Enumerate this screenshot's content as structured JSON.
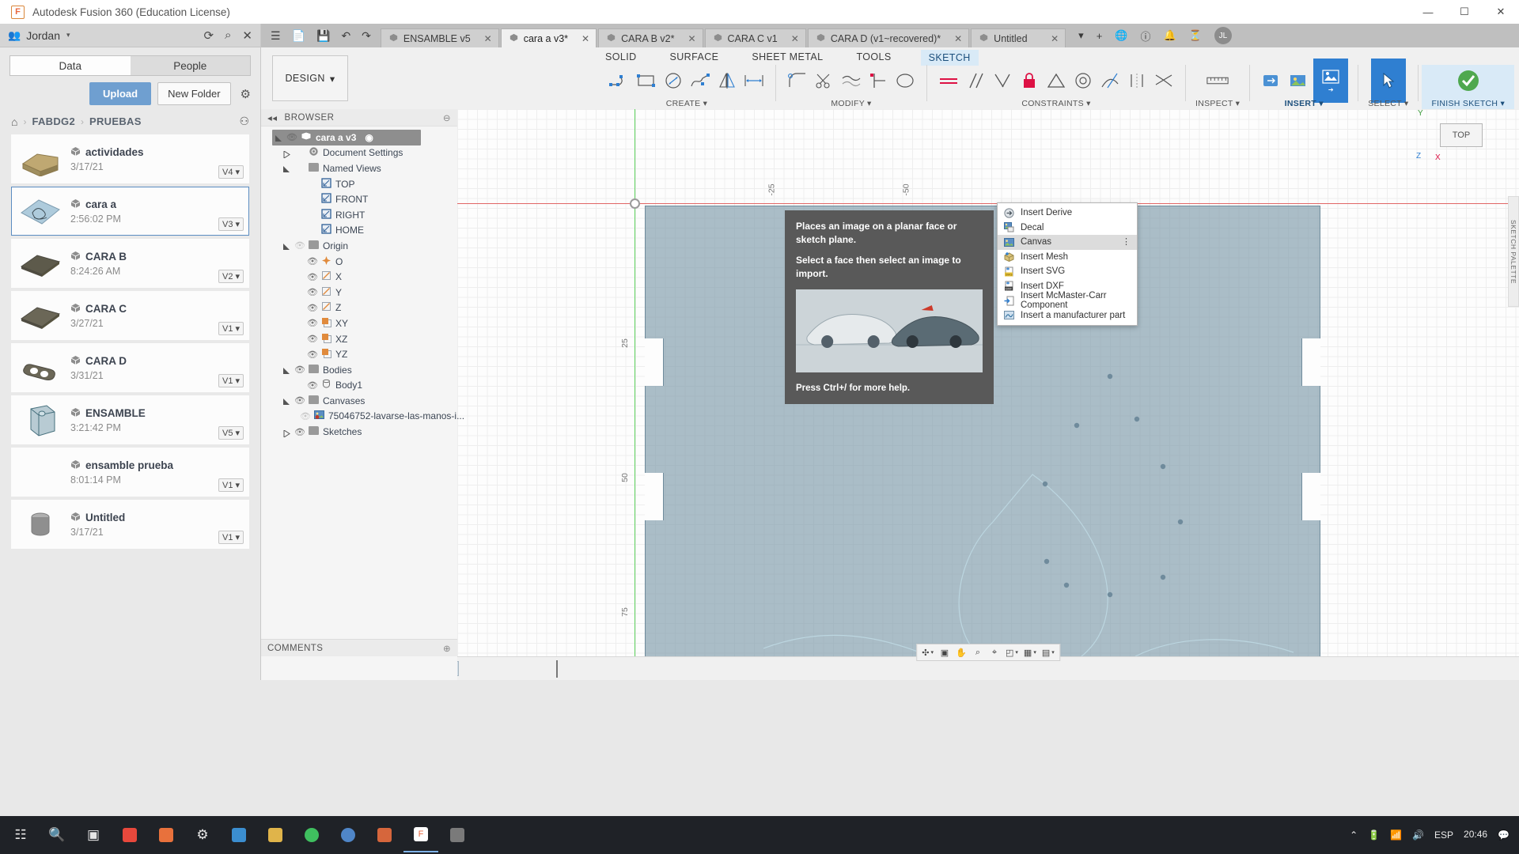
{
  "window": {
    "title": "Autodesk Fusion 360 (Education License)",
    "logo_letter": "F",
    "minimize": "—",
    "maximize": "☐",
    "close": "✕"
  },
  "data_panel": {
    "user": "Jordan",
    "user_caret": "▾",
    "people_icon": "people-icon",
    "refresh_icon": "⟳",
    "search_icon": "⌕",
    "close_icon": "✕",
    "tabs": [
      {
        "label": "Data",
        "active": true
      },
      {
        "label": "People",
        "active": false
      }
    ],
    "upload_label": "Upload",
    "new_folder_label": "New Folder",
    "settings_icon": "⚙",
    "breadcrumb": {
      "home_icon": "⌂",
      "sep": "›",
      "items": [
        "FABDG2",
        "PRUEBAS"
      ],
      "right_icon": "⚇"
    },
    "files": [
      {
        "name": "actividades",
        "date": "3/17/21",
        "version": "V4",
        "selected": false,
        "thumb": "wedge",
        "color": "#bfa872"
      },
      {
        "name": "cara a",
        "date": "2:56:02 PM",
        "version": "V3",
        "selected": true,
        "thumb": "sketch",
        "color": "#aecbdc"
      },
      {
        "name": "CARA B",
        "date": "8:24:26 AM",
        "version": "V2",
        "selected": false,
        "thumb": "plate",
        "color": "#5d5a4b"
      },
      {
        "name": "CARA C",
        "date": "3/27/21",
        "version": "V1",
        "selected": false,
        "thumb": "plate",
        "color": "#6b6757"
      },
      {
        "name": "CARA D",
        "date": "3/31/21",
        "version": "V1",
        "selected": false,
        "thumb": "keyplate",
        "color": "#6b6757"
      },
      {
        "name": "ENSAMBLE",
        "date": "3:21:42 PM",
        "version": "V5",
        "selected": false,
        "thumb": "box",
        "color": "#7fa3b0"
      },
      {
        "name": "ensamble prueba",
        "date": "8:01:14 PM",
        "version": "V1",
        "selected": false,
        "thumb": "none",
        "color": "#cccccc"
      },
      {
        "name": "Untitled",
        "date": "3/17/21",
        "version": "V1",
        "selected": false,
        "thumb": "cyl",
        "color": "#8f8f8f"
      }
    ],
    "version_caret": "▾"
  },
  "quick_access": {
    "icons": [
      "grid-icon",
      "new-file-icon",
      "save-icon",
      "undo-icon",
      "redo-icon"
    ],
    "grid": "☰",
    "newfile": "▢",
    "save": "Ὃe",
    "undo": "↶",
    "redo": "↷"
  },
  "doc_tabs": [
    {
      "label": "ENSAMBLE v5",
      "active": false,
      "close": "✕"
    },
    {
      "label": "cara a v3*",
      "active": true,
      "close": "✕"
    },
    {
      "label": "CARA B v2*",
      "active": false,
      "close": "✕"
    },
    {
      "label": "CARA C v1",
      "active": false,
      "close": "✕"
    },
    {
      "label": "CARA D (v1~recovered)*",
      "active": false,
      "close": "✕"
    },
    {
      "label": "Untitled",
      "active": false,
      "close": "✕"
    }
  ],
  "tab_overflow": "▾",
  "tab_add": "+",
  "title_right_icons": [
    "globe-icon",
    "help-icon",
    "notifications-icon",
    "jobs-icon"
  ],
  "account_initials": "JL",
  "ribbon": {
    "design_label": "DESIGN",
    "design_caret": "▾",
    "workspace_tabs": [
      {
        "label": "SOLID",
        "active": false
      },
      {
        "label": "SURFACE",
        "active": false
      },
      {
        "label": "SHEET METAL",
        "active": false
      },
      {
        "label": "TOOLS",
        "active": false
      },
      {
        "label": "SKETCH",
        "active": true
      }
    ],
    "panels": [
      {
        "label": "CREATE ▾",
        "name": "create-panel"
      },
      {
        "label": "MODIFY ▾",
        "name": "modify-panel"
      },
      {
        "label": "CONSTRAINTS ▾",
        "name": "constraints-panel"
      },
      {
        "label": "INSPECT ▾",
        "name": "inspect-panel"
      },
      {
        "label": "INSERT ▾",
        "name": "insert-panel",
        "active": true
      },
      {
        "label": "SELECT ▾",
        "name": "select-panel"
      },
      {
        "label": "FINISH SKETCH ▾",
        "name": "finish-sketch-panel",
        "finish": true
      }
    ]
  },
  "insert_menu": {
    "items": [
      {
        "label": "Insert Derive",
        "icon": "insert-derive-icon",
        "highlight": false
      },
      {
        "label": "Decal",
        "icon": "decal-icon",
        "highlight": false
      },
      {
        "label": "Canvas",
        "icon": "canvas-icon",
        "highlight": true,
        "more": "⋮"
      },
      {
        "label": "Insert Mesh",
        "icon": "insert-mesh-icon",
        "highlight": false
      },
      {
        "label": "Insert SVG",
        "icon": "insert-svg-icon",
        "highlight": false
      },
      {
        "label": "Insert DXF",
        "icon": "insert-dxf-icon",
        "highlight": false
      },
      {
        "label": "Insert McMaster-Carr Component",
        "icon": "mcmaster-icon",
        "highlight": false
      },
      {
        "label": "Insert a manufacturer part",
        "icon": "manufacturer-part-icon",
        "highlight": false
      }
    ]
  },
  "tooltip": {
    "line1": "Places an image on a planar face or sketch plane.",
    "line2": "Select a face then select an image to import.",
    "footer": "Press Ctrl+/ for more help."
  },
  "browser": {
    "header": "BROWSER",
    "collapse_icon": "◂◂",
    "dock_icon": "⊖",
    "root": {
      "label": "cara a v3",
      "eye": "◉"
    },
    "nodes": [
      {
        "label": "Document Settings",
        "indent": 1,
        "twist": "collapsed",
        "icon": "gear",
        "eye": false
      },
      {
        "label": "Named Views",
        "indent": 1,
        "twist": "expanded",
        "icon": "folder",
        "eye": false
      },
      {
        "label": "TOP",
        "indent": 2,
        "twist": "none",
        "icon": "view",
        "eye": false
      },
      {
        "label": "FRONT",
        "indent": 2,
        "twist": "none",
        "icon": "view",
        "eye": false
      },
      {
        "label": "RIGHT",
        "indent": 2,
        "twist": "none",
        "icon": "view",
        "eye": false
      },
      {
        "label": "HOME",
        "indent": 2,
        "twist": "none",
        "icon": "view",
        "eye": false
      },
      {
        "label": "Origin",
        "indent": 1,
        "twist": "expanded",
        "icon": "folder",
        "eye": true,
        "eye_off": true
      },
      {
        "label": "O",
        "indent": 2,
        "twist": "none",
        "icon": "point",
        "eye": true
      },
      {
        "label": "X",
        "indent": 2,
        "twist": "none",
        "icon": "axis",
        "eye": true
      },
      {
        "label": "Y",
        "indent": 2,
        "twist": "none",
        "icon": "axis",
        "eye": true
      },
      {
        "label": "Z",
        "indent": 2,
        "twist": "none",
        "icon": "axis",
        "eye": true
      },
      {
        "label": "XY",
        "indent": 2,
        "twist": "none",
        "icon": "plane",
        "eye": true
      },
      {
        "label": "XZ",
        "indent": 2,
        "twist": "none",
        "icon": "plane",
        "eye": true
      },
      {
        "label": "YZ",
        "indent": 2,
        "twist": "none",
        "icon": "plane",
        "eye": true
      },
      {
        "label": "Bodies",
        "indent": 1,
        "twist": "expanded",
        "icon": "folder",
        "eye": true
      },
      {
        "label": "Body1",
        "indent": 2,
        "twist": "none",
        "icon": "body",
        "eye": true
      },
      {
        "label": "Canvases",
        "indent": 1,
        "twist": "expanded",
        "icon": "folder",
        "eye": true
      },
      {
        "label": "75046752-lavarse-las-manos-i...",
        "indent": 2,
        "twist": "none",
        "icon": "image",
        "eye": true,
        "eye_off": true
      },
      {
        "label": "Sketches",
        "indent": 1,
        "twist": "collapsed",
        "icon": "folder",
        "eye": true
      }
    ]
  },
  "canvas": {
    "ruler_top": [
      "-25",
      "-50"
    ],
    "ruler_left": [
      "25",
      "50",
      "75"
    ],
    "viewcube_label": "TOP",
    "axis_x": "X",
    "axis_y": "Y",
    "axis_z": "Z"
  },
  "palette_label": "SKETCH PALETTE",
  "navbar": {
    "items": [
      "orbit-icon",
      "pan-view-icon",
      "pan-icon",
      "zoom-icon",
      "fit-icon",
      "display-icon",
      "grid-icon",
      "layout-icon"
    ],
    "glyphs": [
      "✣",
      "▣",
      "✋",
      "⌕",
      "⌖",
      "◰",
      "▦",
      "▤"
    ],
    "caret": "▾"
  },
  "comments": {
    "label": "COMMENTS",
    "expand": "⊕"
  },
  "timeline": {
    "controls": [
      "⏮",
      "◀",
      "▶",
      "▶",
      "⏭"
    ],
    "nodes": 5
  },
  "taskbar": {
    "icons": [
      "start-icon",
      "search-icon",
      "taskview-icon",
      "chrome-icon",
      "firefox-icon",
      "settings-icon",
      "edge-icon",
      "explorer-icon",
      "spotify-icon",
      "browser-icon",
      "word-icon",
      "fusion-icon",
      "other-icon"
    ],
    "tray": {
      "chevron": "⌃",
      "battery": "🔋",
      "network": "📶",
      "volume": "🔊",
      "lang": "ESP",
      "time": "20:46",
      "notify": "💬"
    }
  }
}
